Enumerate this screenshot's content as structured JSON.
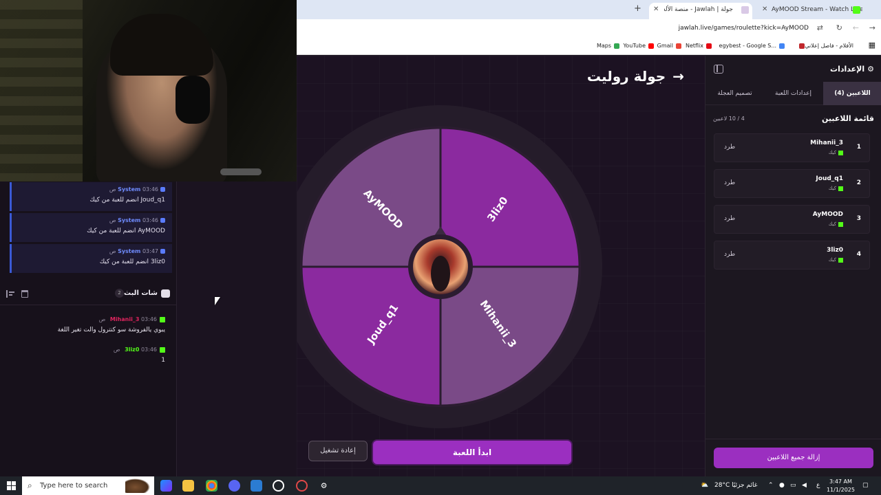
{
  "browser": {
    "tabs": [
      {
        "label": "AyMOOD Stream - Watch Live"
      },
      {
        "label": "جولة | Jawlah - منصة الألعاب الت"
      }
    ],
    "url": "jawlah.live/games/roulette?kick=AyMOOD",
    "bookmarks": [
      "Maps",
      "YouTube",
      "Gmail",
      "Netflix",
      "egybest - Google S...",
      "الأفلام - فاصل إعلاني"
    ]
  },
  "system_messages": [
    {
      "sender": "System",
      "time": "03:46 ص",
      "text": "Joud_q1 انضم للعبة من كيك"
    },
    {
      "sender": "System",
      "time": "03:46 ص",
      "text": "AyMOOD انضم للعبة من كيك"
    },
    {
      "sender": "System",
      "time": "03:47 ص",
      "text": "3liz0 انضم للعبة من كيك"
    }
  ],
  "chat": {
    "title": "شات البث",
    "count": "2",
    "messages": [
      {
        "user": "Mihanii_3",
        "user_color": "#e0245e",
        "time": "03:46 ص",
        "text": "يبوي يالفروشة سو كنترول والت تغير اللغة"
      },
      {
        "user": "3liz0",
        "user_color": "#53fc18",
        "time": "03:46 ص",
        "text": "1"
      }
    ]
  },
  "game": {
    "title": "جولة روليت",
    "start_button": "ابدأ اللعبة",
    "restart_button": "إعادة تشغيل",
    "wheel": {
      "segments": [
        {
          "label": "AyMOOD",
          "color": "#7a4a87"
        },
        {
          "label": "3liz0",
          "color": "#8b2a9f"
        },
        {
          "label": "Mihanii_3",
          "color": "#7a4a87"
        },
        {
          "label": "Joud_q1",
          "color": "#8b2a9f"
        }
      ]
    }
  },
  "settings": {
    "title": "الإعدادات",
    "tabs": [
      "اللاعبين (4)",
      "إعدادات اللعبة",
      "تصميم العجلة"
    ],
    "players_title": "قائمة اللاعبين",
    "players_count": "4 / 10 لاعبين",
    "platform_label": "كيك",
    "kick_label": "طرد",
    "players": [
      {
        "num": "1",
        "name": "Mihanii_3"
      },
      {
        "num": "2",
        "name": "Joud_q1"
      },
      {
        "num": "3",
        "name": "AyMOOD"
      },
      {
        "num": "4",
        "name": "3liz0"
      }
    ],
    "remove_all_button": "إزالة جميع اللاعبين"
  },
  "taskbar": {
    "search_placeholder": "Type here to search",
    "weather": "28°C  غائم جزئيًا",
    "lang": "ع",
    "time": "3:47 AM",
    "date": "11/1/2025"
  },
  "colors": {
    "accent": "#9b2fc0",
    "kick_green": "#53fc18",
    "system_blue": "#6f8cff"
  }
}
